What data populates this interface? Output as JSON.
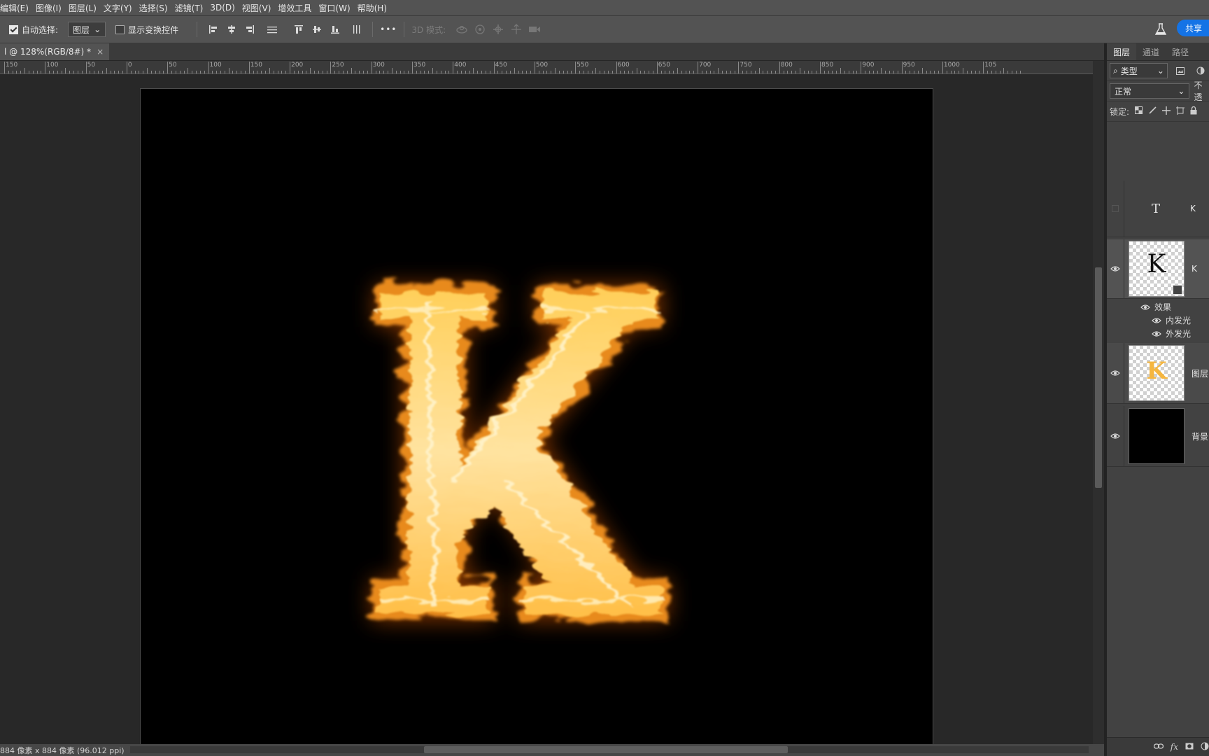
{
  "menu": [
    "编辑(E)",
    "图像(I)",
    "图层(L)",
    "文字(Y)",
    "选择(S)",
    "滤镜(T)",
    "3D(D)",
    "视图(V)",
    "增效工具",
    "窗口(W)",
    "帮助(H)"
  ],
  "options": {
    "auto_select_label": "自动选择:",
    "auto_select_target": "图层",
    "show_transform_label": "显示变换控件",
    "mode_3d_label": "3D 模式:",
    "more_label": "•••",
    "share_label": "共享"
  },
  "document_tab": {
    "title": "l @ 128%(RGB/8#) *",
    "close": "×"
  },
  "ruler": {
    "labels": [
      "150",
      "100",
      "50",
      "0",
      "50",
      "100",
      "150",
      "200",
      "250",
      "300",
      "350",
      "400",
      "450",
      "500",
      "550",
      "600",
      "650",
      "700",
      "750",
      "800",
      "850",
      "900",
      "950",
      "1000",
      "105"
    ]
  },
  "status": {
    "doc_info": "884 像素 x 884 像素 (96.012 ppi)",
    "arrow": "›"
  },
  "layers_panel": {
    "tabs": [
      "图层",
      "通道",
      "路径"
    ],
    "filter_label": "类型",
    "blend_mode": "正常",
    "opacity_label": "不透",
    "lock_label": "锁定:",
    "layers": [
      {
        "name": "K",
        "kind": "text"
      },
      {
        "name": "K",
        "kind": "smart"
      },
      {
        "name": "图层",
        "kind": "fire"
      },
      {
        "name": "背景",
        "kind": "background"
      }
    ],
    "effects_label": "效果",
    "effects": [
      "内发光",
      "外发光"
    ],
    "thumb_text": "K",
    "text_icon": "T",
    "bottom_icons": [
      "link-icon",
      "fx-icon",
      "mask-icon",
      "adjustment-icon"
    ],
    "fx_text": "fx"
  },
  "colors": {
    "accent": "#1473e6",
    "fire_core": "#ffe9a0",
    "fire_mid": "#ffb12e",
    "fire_edge": "#c85a00"
  }
}
